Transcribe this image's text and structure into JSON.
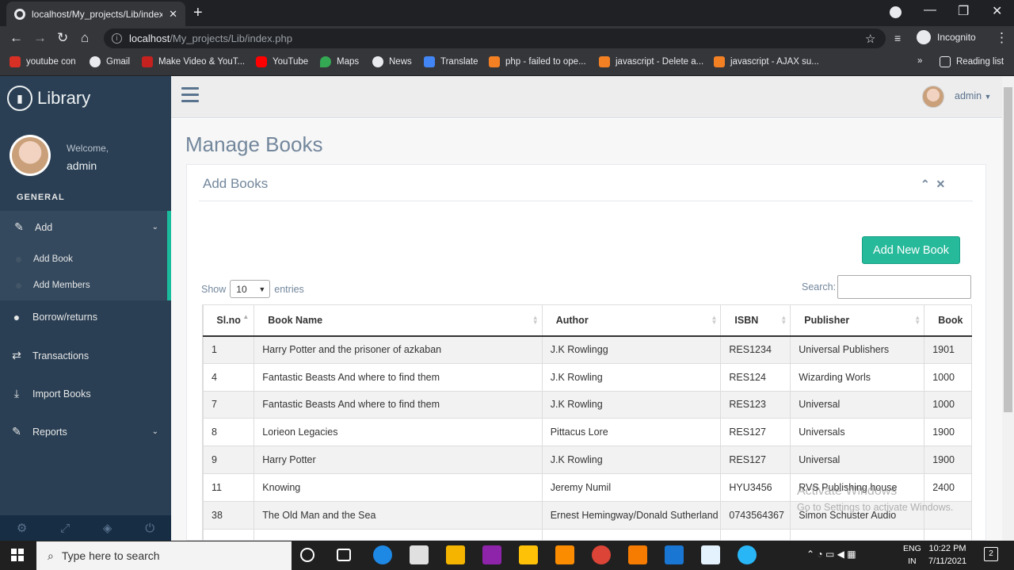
{
  "browser": {
    "tab_title": "localhost/My_projects/Lib/index.",
    "url_host": "localhost",
    "url_path": "/My_projects/Lib/index.php",
    "incognito_label": "Incognito",
    "bookmarks": [
      "youtube con",
      "Gmail",
      "Make Video & YouT...",
      "YouTube",
      "Maps",
      "News",
      "Translate",
      "php - failed to ope...",
      "javascript - Delete a...",
      "javascript - AJAX su..."
    ],
    "reading_list": "Reading list"
  },
  "sidebar": {
    "brand": "Library",
    "welcome": "Welcome,",
    "username": "admin",
    "section": "GENERAL",
    "menu": {
      "add": "Add",
      "add_book": "Add Book",
      "add_members": "Add Members",
      "borrow": "Borrow/returns",
      "transactions": "Transactions",
      "import": "Import Books",
      "reports": "Reports"
    }
  },
  "topnav": {
    "user": "admin"
  },
  "page": {
    "title": "Manage Books",
    "panel_title": "Add Books",
    "add_button": "Add New Book",
    "show_label": "Show",
    "entries_value": "10",
    "entries_label": "entries",
    "search_label": "Search:"
  },
  "table": {
    "headers": [
      "Sl.no",
      "Book Name",
      "Author",
      "ISBN",
      "Publisher",
      "Book"
    ],
    "rows": [
      [
        "1",
        "Harry Potter and the prisoner of azkaban",
        "J.K Rowlingg",
        "RES1234",
        "Universal Publishers",
        "1901"
      ],
      [
        "4",
        "Fantastic Beasts And where to find them",
        "J.K Rowling",
        "RES124",
        "Wizarding Worls",
        "1000"
      ],
      [
        "7",
        "Fantastic Beasts And where to find them",
        "J.K Rowling",
        "RES123",
        "Universal",
        "1000"
      ],
      [
        "8",
        "Lorieon Legacies",
        "Pittacus Lore",
        "RES127",
        "Universals",
        "1900"
      ],
      [
        "9",
        "Harry Potter",
        "J.K Rowling",
        "RES127",
        "Universal",
        "1900"
      ],
      [
        "11",
        "Knowing",
        "Jeremy Numil",
        "HYU3456",
        "RVS Publishing house",
        "2400"
      ],
      [
        "38",
        "The Old Man and the Sea",
        "Ernest Hemingway/Donald Sutherland",
        "0743564367",
        "Simon Schuster Audio",
        ""
      ]
    ]
  },
  "watermark": {
    "line1": "Activate Windows",
    "line2": "Go to Settings to activate Windows."
  },
  "taskbar": {
    "search_placeholder": "Type here to search",
    "lang1": "ENG",
    "lang2": "IN",
    "time": "10:22 PM",
    "date": "7/11/2021",
    "notif_count": "2"
  },
  "colors": {
    "sidebar": "#2a3f54",
    "accent": "#26b99a",
    "text": "#73879c"
  }
}
